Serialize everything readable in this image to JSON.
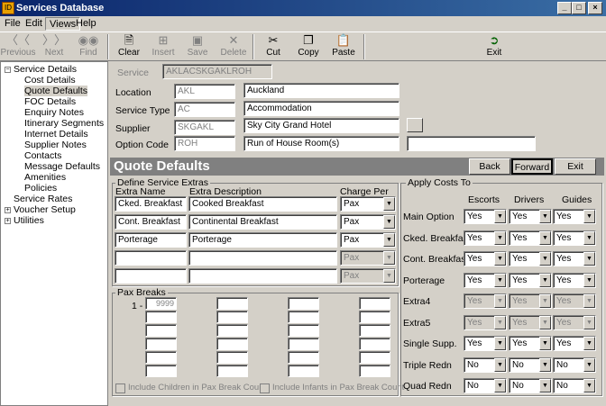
{
  "window": {
    "title": "Services Database",
    "icon": "ID",
    "minimize": "_",
    "maximize": "□",
    "close": "×"
  },
  "menu": {
    "file": "File",
    "edit": "Edit",
    "views": "Views",
    "help": "Help"
  },
  "toolbar": {
    "previous": "Previous",
    "next": "Next",
    "find": "Find",
    "clear": "Clear",
    "insert": "Insert",
    "save": "Save",
    "delete": "Delete",
    "cut": "Cut",
    "copy": "Copy",
    "paste": "Paste",
    "exit": "Exit"
  },
  "tree": {
    "service_details": "Service Details",
    "cost_details": "Cost Details",
    "quote_defaults": "Quote Defaults",
    "foc_details": "FOC Details",
    "enquiry_notes": "Enquiry Notes",
    "itinerary_segments": "Itinerary Segments",
    "internet_details": "Internet Details",
    "supplier_notes": "Supplier Notes",
    "contacts": "Contacts",
    "message_defaults": "Message Defaults",
    "amenities": "Amenities",
    "policies": "Policies",
    "service_rates": "Service Rates",
    "voucher_setup": "Voucher Setup",
    "utilities": "Utilities"
  },
  "header": {
    "service_label": "Service",
    "service_code": "AKLACSKGAKLROH",
    "location_label": "Location",
    "location_code": "AKL",
    "location_name": "Auckland",
    "service_type_label": "Service Type",
    "service_type_code": "AC",
    "service_type_name": "Accommodation",
    "supplier_label": "Supplier",
    "supplier_code": "SKGAKL",
    "supplier_name": "Sky City Grand Hotel",
    "option_code_label": "Option Code",
    "option_code": "ROH",
    "option_name": "Run of House Room(s)"
  },
  "quote": {
    "title": "Quote Defaults",
    "back": "Back",
    "forward": "Forward",
    "exit": "Exit"
  },
  "extras": {
    "group_label": "Define Service Extras",
    "col_name": "Extra Name",
    "col_desc": "Extra Description",
    "col_charge": "Charge Per",
    "rows": [
      {
        "name": "Cked. Breakfast",
        "desc": "Cooked Breakfast",
        "charge": "Pax"
      },
      {
        "name": "Cont. Breakfast",
        "desc": "Continental Breakfast",
        "charge": "Pax"
      },
      {
        "name": "Porterage",
        "desc": "Porterage",
        "charge": "Pax"
      },
      {
        "name": "",
        "desc": "",
        "charge": "Pax"
      },
      {
        "name": "",
        "desc": "",
        "charge": "Pax"
      }
    ]
  },
  "pax": {
    "group_label": "Pax Breaks",
    "first_prefix": "1 -",
    "first_value": "9999",
    "include_children": "Include Children in Pax Break Count",
    "include_infants": "Include Infants in Pax Break Count"
  },
  "apply": {
    "group_label": "Apply Costs To",
    "col_escorts": "Escorts",
    "col_drivers": "Drivers",
    "col_guides": "Guides",
    "rows": [
      {
        "label": "Main Option",
        "e": "Yes",
        "d": "Yes",
        "g": "Yes"
      },
      {
        "label": "Cked. Breakfast",
        "e": "Yes",
        "d": "Yes",
        "g": "Yes"
      },
      {
        "label": "Cont. Breakfast",
        "e": "Yes",
        "d": "Yes",
        "g": "Yes"
      },
      {
        "label": "Porterage",
        "e": "Yes",
        "d": "Yes",
        "g": "Yes"
      },
      {
        "label": "Extra4",
        "e": "Yes",
        "d": "Yes",
        "g": "Yes"
      },
      {
        "label": "Extra5",
        "e": "Yes",
        "d": "Yes",
        "g": "Yes"
      },
      {
        "label": "Single Supp.",
        "e": "Yes",
        "d": "Yes",
        "g": "Yes"
      },
      {
        "label": "Triple Redn",
        "e": "No",
        "d": "No",
        "g": "No"
      },
      {
        "label": "Quad Redn",
        "e": "No",
        "d": "No",
        "g": "No"
      }
    ]
  }
}
